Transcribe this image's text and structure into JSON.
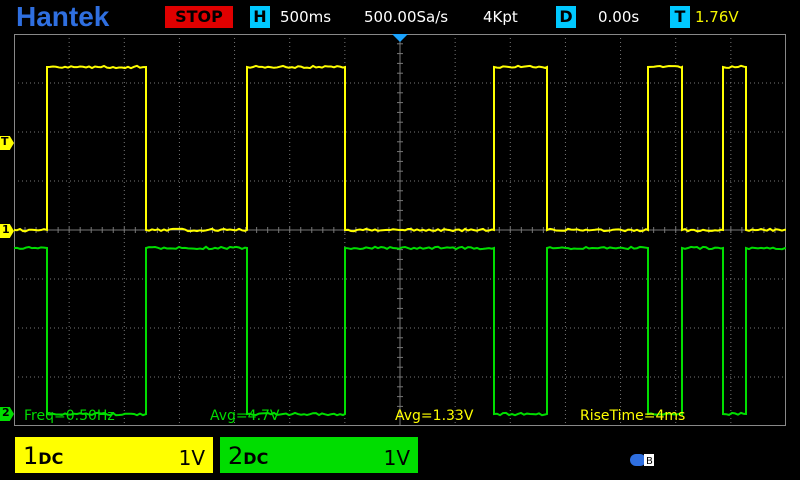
{
  "header": {
    "brand": "Hantek",
    "run_state": "STOP",
    "h_badge": "H",
    "timebase": "500ms",
    "sample_rate": "500.00Sa/s",
    "memory_depth": "4Kpt",
    "d_badge": "D",
    "delay": "0.00s",
    "t_badge": "T",
    "trigger_level": "1.76V"
  },
  "markers": {
    "trigger_marker": "T",
    "ch1_marker": "1",
    "ch2_marker": "2"
  },
  "measurements": {
    "freq": "Freq=0.50Hz",
    "avg_ch2": "Avg=4.7V",
    "avg_ch1": "Avg=1.33V",
    "rise_time": "RiseTime=4ms"
  },
  "channels": [
    {
      "name": "1",
      "coupling": "DC",
      "scale": "1V",
      "color": "#ffff00"
    },
    {
      "name": "2",
      "coupling": "DC",
      "scale": "1V",
      "color": "#00dd00"
    }
  ],
  "colors": {
    "brand": "#2f6fe0",
    "stop": "#e00000",
    "badge": "#00c8ff",
    "ch1": "#ffff00",
    "ch2": "#00dd00",
    "grid": "#7a7a7a"
  }
}
